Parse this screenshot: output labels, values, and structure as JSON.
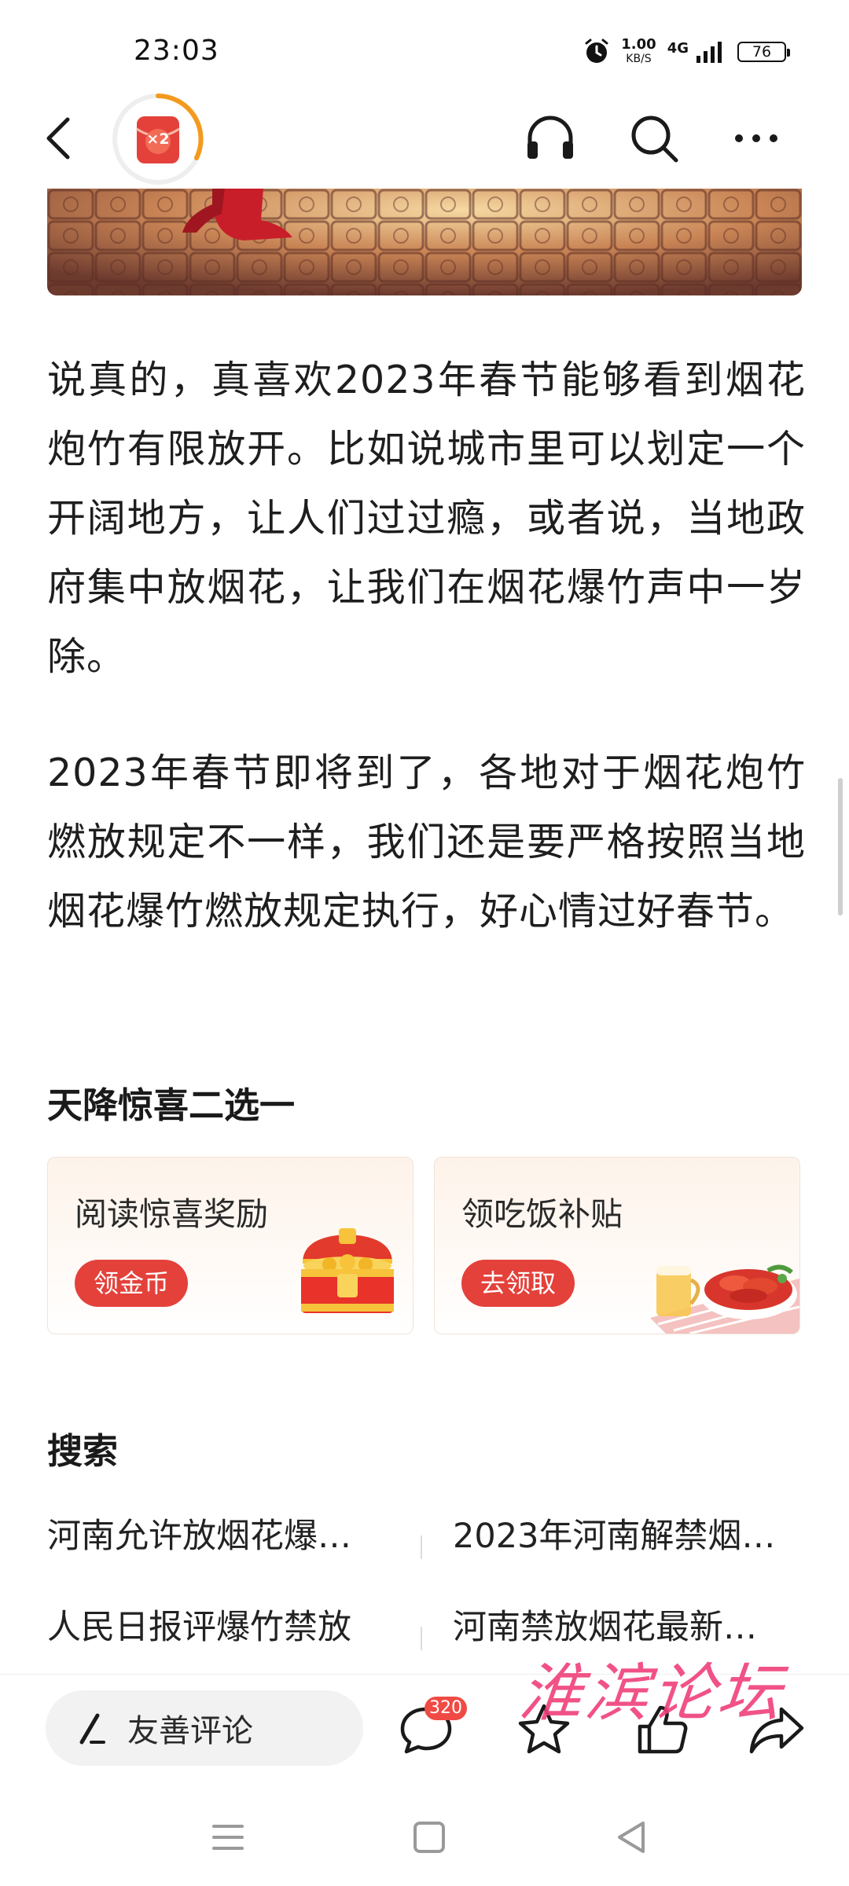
{
  "status_bar": {
    "time": "23:03",
    "net_speed": "1.00",
    "net_speed_unit": "KB/S",
    "network": "4G",
    "battery": "76",
    "icons": [
      "alarm-icon",
      "signal-icon",
      "battery-icon"
    ]
  },
  "header": {
    "reward_badge": "×2",
    "icons": [
      "back-icon",
      "red-envelope-icon",
      "headphones-icon",
      "search-icon",
      "more-icon"
    ]
  },
  "article": {
    "paragraphs": [
      "说真的，真喜欢2023年春节能够看到烟花炮竹有限放开。比如说城市里可以划定一个开阔地方，让人们过过瘾，或者说，当地政府集中放烟花，让我们在烟花爆竹声中一岁除。",
      "2023年春节即将到了，各地对于烟花炮竹燃放规定不一样，我们还是要严格按照当地烟花爆竹燃放规定执行，好心情过好春节。"
    ]
  },
  "surprise": {
    "title": "天降惊喜二选一",
    "cards": [
      {
        "title": "阅读惊喜奖励",
        "button": "领金币",
        "image": "treasure-chest-icon"
      },
      {
        "title": "领吃饭补贴",
        "button": "去领取",
        "image": "crawfish-meal-icon"
      }
    ]
  },
  "search": {
    "title": "搜索",
    "items": [
      "河南允许放烟花爆…",
      "2023年河南解禁烟…",
      "人民日报评爆竹禁放",
      "河南禁放烟花最新…"
    ]
  },
  "bottom_bar": {
    "comment_placeholder": "友善评论",
    "comment_count": "320",
    "icons": [
      "pen-icon",
      "comment-icon",
      "star-icon",
      "thumbs-up-icon",
      "share-icon"
    ]
  },
  "watermark": "淮滨论坛",
  "nav_bar": {
    "icons": [
      "menu-icon",
      "home-icon",
      "back-triangle-icon"
    ]
  },
  "colors": {
    "accent_red": "#e4413b",
    "badge_red": "#f04a44",
    "reward_orange": "#f39a1e",
    "watermark_pink": "#f0407a"
  }
}
